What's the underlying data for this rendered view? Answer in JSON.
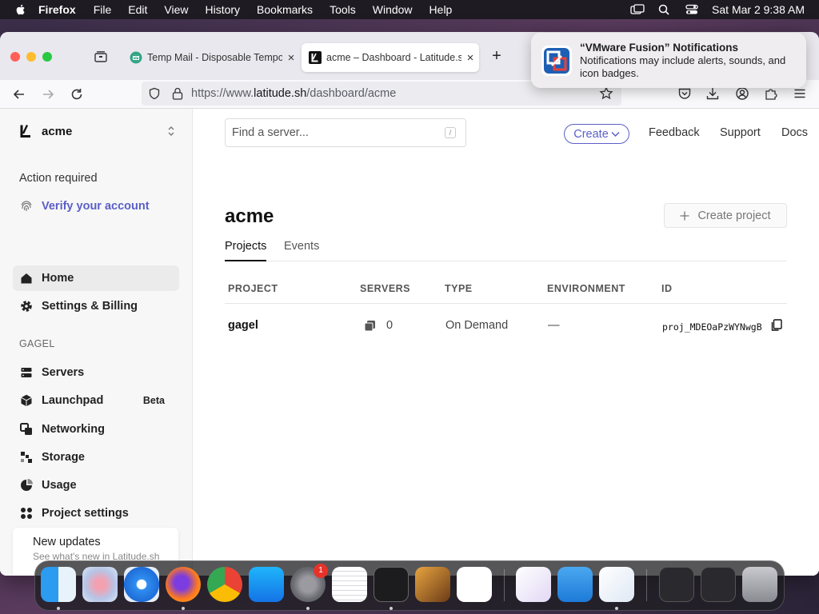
{
  "menubar": {
    "app_name": "Firefox",
    "items": [
      "File",
      "Edit",
      "View",
      "History",
      "Bookmarks",
      "Tools",
      "Window",
      "Help"
    ],
    "clock": "Sat Mar 2  9:38 AM"
  },
  "browser": {
    "tabs": [
      {
        "title": "Temp Mail - Disposable Tempor"
      },
      {
        "title": "acme – Dashboard - Latitude.sh"
      }
    ],
    "url_prefix": "https://www.",
    "url_domain": "latitude.sh",
    "url_path": "/dashboard/acme"
  },
  "sidebar": {
    "org_name": "acme",
    "action_heading": "Action required",
    "verify_label": "Verify your account",
    "home_label": "Home",
    "settings_billing_label": "Settings & Billing",
    "section_label": "GAGEL",
    "items": [
      {
        "label": "Servers",
        "icon": "servers-icon"
      },
      {
        "label": "Launchpad",
        "icon": "cube-icon",
        "badge": "Beta"
      },
      {
        "label": "Networking",
        "icon": "network-icon"
      },
      {
        "label": "Storage",
        "icon": "storage-icon"
      },
      {
        "label": "Usage",
        "icon": "usage-icon"
      },
      {
        "label": "Project settings",
        "icon": "grid-icon"
      }
    ],
    "updates_title": "New updates",
    "updates_subtitle": "See what's new in Latitude.sh"
  },
  "topbar": {
    "search_placeholder": "Find a server...",
    "search_shortcut": "/",
    "create_label": "Create",
    "links": [
      "Feedback",
      "Support",
      "Docs"
    ]
  },
  "main": {
    "title": "acme",
    "create_project_label": "Create project",
    "tabs": [
      "Projects",
      "Events"
    ],
    "active_tab": "Projects",
    "table": {
      "headers": [
        "PROJECT",
        "SERVERS",
        "TYPE",
        "ENVIRONMENT",
        "ID"
      ],
      "rows": [
        {
          "project": "gagel",
          "servers": "0",
          "type": "On Demand",
          "environment": "—",
          "id": "proj_MDEOaPzWYNwgB"
        }
      ]
    }
  },
  "notification": {
    "title": "“VMware Fusion” Notifications",
    "body": "Notifications may include alerts, sounds, and icon badges."
  },
  "dock": {
    "apps": [
      "finder",
      "launchpad",
      "safari",
      "firefox",
      "chrome",
      "app-store",
      "system-settings",
      "textedit",
      "terminal",
      "garageband",
      "vscode",
      "visual-studio",
      "icloud",
      "vmware-fusion"
    ],
    "settings_badge": "1"
  },
  "colors": {
    "accent": "#5b5fc7",
    "sidebar_bg": "#f7f7f7",
    "selected_bg": "#ebebeb"
  }
}
